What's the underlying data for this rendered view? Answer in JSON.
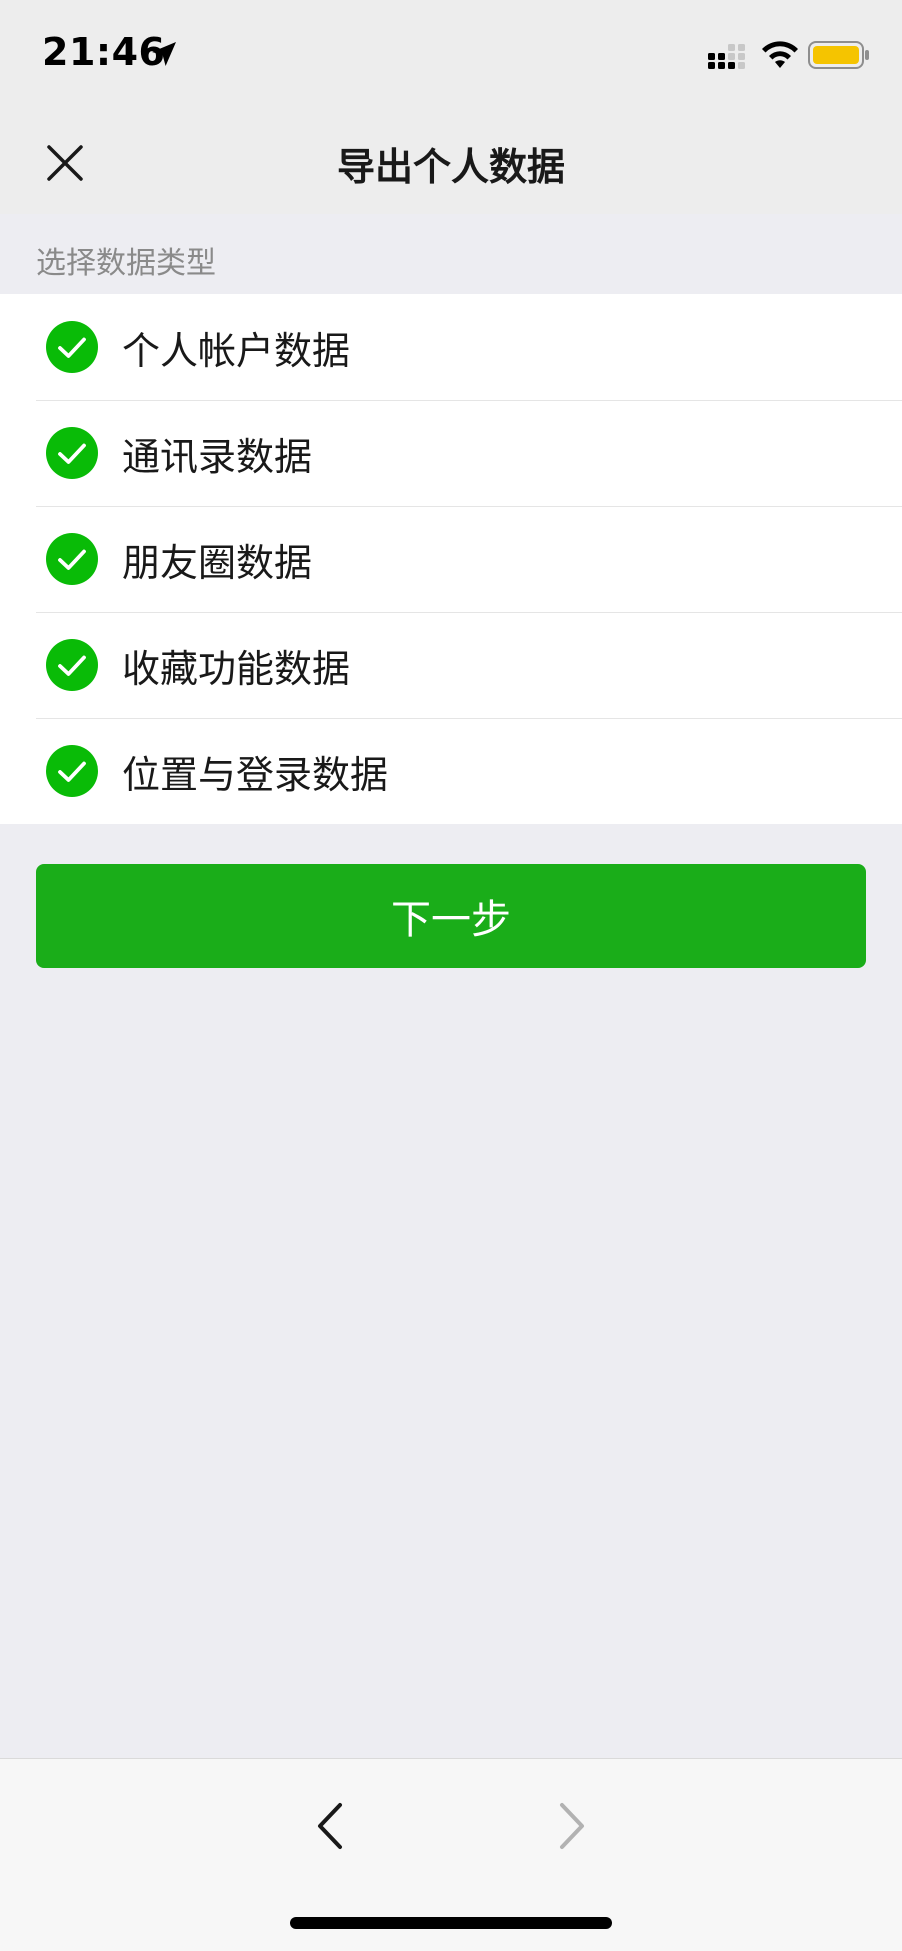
{
  "status_bar": {
    "time": "21:46",
    "icons": [
      "location-arrow-icon",
      "cellular-signal-icon",
      "wifi-icon",
      "battery-icon"
    ],
    "battery_color": "#F5C400"
  },
  "nav": {
    "title": "导出个人数据",
    "close_icon": "close-icon"
  },
  "section": {
    "header": "选择数据类型"
  },
  "options": [
    {
      "label": "个人帐户数据",
      "checked": true
    },
    {
      "label": "通讯录数据",
      "checked": true
    },
    {
      "label": "朋友圈数据",
      "checked": true
    },
    {
      "label": "收藏功能数据",
      "checked": true
    },
    {
      "label": "位置与登录数据",
      "checked": true
    }
  ],
  "next_button": {
    "label": "下一步"
  },
  "toolbar": {
    "back_icon": "chevron-left-icon",
    "forward_icon": "chevron-right-icon"
  },
  "colors": {
    "accent": "#1AAD19",
    "check": "#09BB07",
    "background": "#EDEDF2"
  }
}
